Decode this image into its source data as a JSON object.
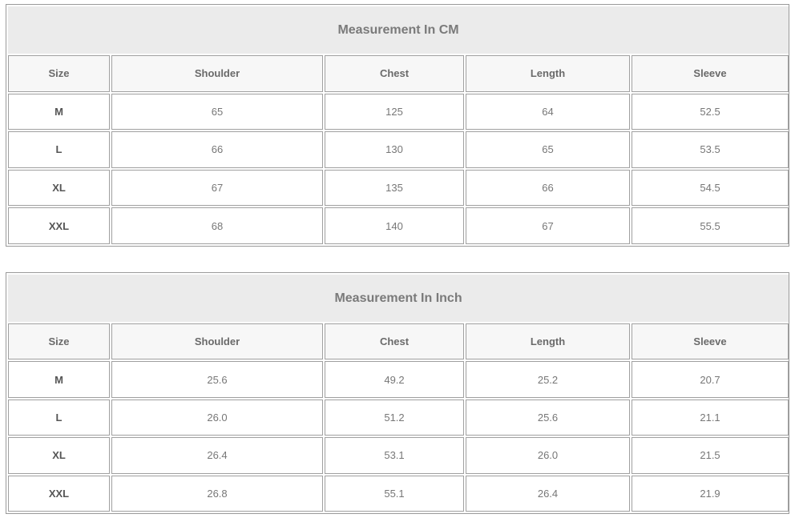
{
  "tables": [
    {
      "title": "Measurement In CM",
      "headers": [
        "Size",
        "Shoulder",
        "Chest",
        "Length",
        "Sleeve"
      ],
      "rows": [
        [
          "M",
          "65",
          "125",
          "64",
          "52.5"
        ],
        [
          "L",
          "66",
          "130",
          "65",
          "53.5"
        ],
        [
          "XL",
          "67",
          "135",
          "66",
          "54.5"
        ],
        [
          "XXL",
          "68",
          "140",
          "67",
          "55.5"
        ]
      ]
    },
    {
      "title": "Measurement In Inch",
      "headers": [
        "Size",
        "Shoulder",
        "Chest",
        "Length",
        "Sleeve"
      ],
      "rows": [
        [
          "M",
          "25.6",
          "49.2",
          "25.2",
          "20.7"
        ],
        [
          "L",
          "26.0",
          "51.2",
          "25.6",
          "21.1"
        ],
        [
          "XL",
          "26.4",
          "53.1",
          "26.0",
          "21.5"
        ],
        [
          "XXL",
          "26.8",
          "55.1",
          "26.4",
          "21.9"
        ]
      ]
    }
  ]
}
